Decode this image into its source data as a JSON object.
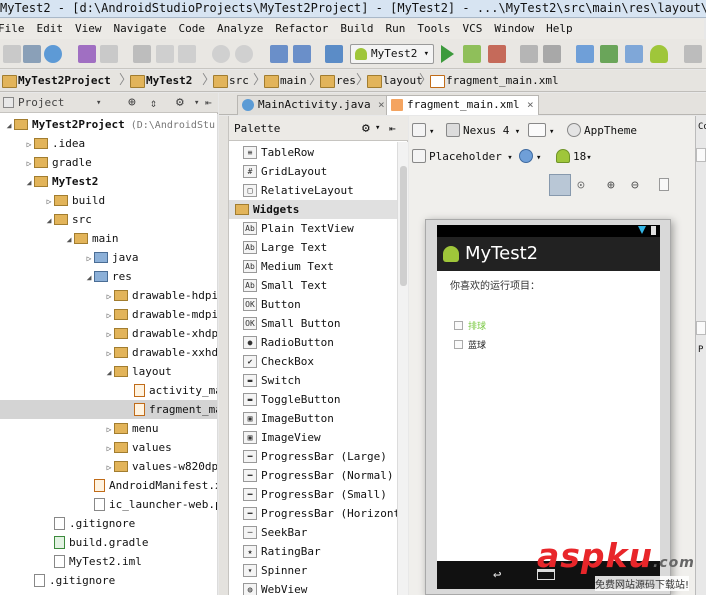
{
  "window": {
    "title": "MyTest2 - [d:\\AndroidStudioProjects\\MyTest2Project] - [MyTest2] - ...\\MyTest2\\src\\main\\res\\layout\\fragment_main.xml"
  },
  "menu": [
    "File",
    "Edit",
    "View",
    "Navigate",
    "Code",
    "Analyze",
    "Refactor",
    "Build",
    "Run",
    "Tools",
    "VCS",
    "Window",
    "Help"
  ],
  "toolbar": {
    "run_config": "MyTest2"
  },
  "breadcrumb": [
    "MyTest2Project",
    "MyTest2",
    "src",
    "main",
    "res",
    "layout",
    "fragment_main.xml"
  ],
  "project_pane": {
    "view_label": "Project",
    "items": [
      {
        "label": "MyTest2Project",
        "hint": "(D:\\AndroidStu",
        "level": 0,
        "kind": "folder",
        "bold": true
      },
      {
        "label": ".idea",
        "level": 1,
        "kind": "folder"
      },
      {
        "label": "gradle",
        "level": 1,
        "kind": "folder"
      },
      {
        "label": "MyTest2",
        "level": 1,
        "kind": "folder",
        "bold": true
      },
      {
        "label": "build",
        "level": 2,
        "kind": "folder"
      },
      {
        "label": "src",
        "level": 2,
        "kind": "folder"
      },
      {
        "label": "main",
        "level": 3,
        "kind": "folder"
      },
      {
        "label": "java",
        "level": 4,
        "kind": "folder-blue"
      },
      {
        "label": "res",
        "level": 4,
        "kind": "folder-blue"
      },
      {
        "label": "drawable-hdpi",
        "level": 5,
        "kind": "folder"
      },
      {
        "label": "drawable-mdpi",
        "level": 5,
        "kind": "folder"
      },
      {
        "label": "drawable-xhdpi",
        "level": 5,
        "kind": "folder"
      },
      {
        "label": "drawable-xxhdp",
        "level": 5,
        "kind": "folder"
      },
      {
        "label": "layout",
        "level": 5,
        "kind": "folder"
      },
      {
        "label": "activity_ma",
        "level": 6,
        "kind": "xml"
      },
      {
        "label": "fragment_ma",
        "level": 6,
        "kind": "xml",
        "selected": true
      },
      {
        "label": "menu",
        "level": 5,
        "kind": "folder"
      },
      {
        "label": "values",
        "level": 5,
        "kind": "folder"
      },
      {
        "label": "values-w820dp",
        "level": 5,
        "kind": "folder"
      },
      {
        "label": "AndroidManifest.xm",
        "level": 4,
        "kind": "xml"
      },
      {
        "label": "ic_launcher-web.pn",
        "level": 4,
        "kind": "file"
      },
      {
        "label": ".gitignore",
        "level": 2,
        "kind": "file"
      },
      {
        "label": "build.gradle",
        "level": 2,
        "kind": "gradle"
      },
      {
        "label": "MyTest2.iml",
        "level": 2,
        "kind": "file"
      },
      {
        "label": ".gitignore",
        "level": 1,
        "kind": "file"
      }
    ]
  },
  "editor_tabs": [
    {
      "label": "MainActivity.java",
      "active": false
    },
    {
      "label": "fragment_main.xml",
      "active": true
    }
  ],
  "palette": {
    "title": "Palette",
    "items": [
      {
        "label": "TableRow",
        "icon": "table-row-icon",
        "glyph": "≡"
      },
      {
        "label": "GridLayout",
        "icon": "grid-layout-icon",
        "glyph": "#"
      },
      {
        "label": "RelativeLayout",
        "icon": "relative-layout-icon",
        "glyph": "□"
      },
      {
        "label": "Widgets",
        "category": true
      },
      {
        "label": "Plain TextView",
        "icon": "textview-icon",
        "glyph": "Ab"
      },
      {
        "label": "Large Text",
        "icon": "large-text-icon",
        "glyph": "Ab"
      },
      {
        "label": "Medium Text",
        "icon": "medium-text-icon",
        "glyph": "Ab"
      },
      {
        "label": "Small Text",
        "icon": "small-text-icon",
        "glyph": "Ab"
      },
      {
        "label": "Button",
        "icon": "button-icon",
        "glyph": "OK"
      },
      {
        "label": "Small Button",
        "icon": "small-button-icon",
        "glyph": "OK"
      },
      {
        "label": "RadioButton",
        "icon": "radio-button-icon",
        "glyph": "●"
      },
      {
        "label": "CheckBox",
        "icon": "checkbox-icon",
        "glyph": "✔"
      },
      {
        "label": "Switch",
        "icon": "switch-icon",
        "glyph": "▬"
      },
      {
        "label": "ToggleButton",
        "icon": "toggle-button-icon",
        "glyph": "▬"
      },
      {
        "label": "ImageButton",
        "icon": "image-button-icon",
        "glyph": "▣"
      },
      {
        "label": "ImageView",
        "icon": "image-view-icon",
        "glyph": "▣"
      },
      {
        "label": "ProgressBar (Large)",
        "icon": "progressbar-icon",
        "glyph": "━"
      },
      {
        "label": "ProgressBar (Normal)",
        "icon": "progressbar-icon",
        "glyph": "━"
      },
      {
        "label": "ProgressBar (Small)",
        "icon": "progressbar-icon",
        "glyph": "━"
      },
      {
        "label": "ProgressBar (Horizontal)",
        "icon": "progressbar-icon",
        "glyph": "━"
      },
      {
        "label": "SeekBar",
        "icon": "seekbar-icon",
        "glyph": "─"
      },
      {
        "label": "RatingBar",
        "icon": "star-icon",
        "glyph": "★"
      },
      {
        "label": "Spinner",
        "icon": "spinner-icon",
        "glyph": "▾"
      },
      {
        "label": "WebView",
        "icon": "globe-icon",
        "glyph": "◍"
      }
    ]
  },
  "design_toolbar": {
    "device": "Nexus 4",
    "theme": "AppTheme",
    "placeholder": "Placeholder",
    "api": "18"
  },
  "device_preview": {
    "app_title": "MyTest2",
    "prompt": "你喜欢的运行项目：",
    "options": [
      {
        "label": "排球",
        "color": "#7ac943"
      },
      {
        "label": "蓝球",
        "color": "#222222"
      }
    ]
  },
  "watermark": {
    "brand": "aspku",
    "suffix": ".com",
    "tagline": "免费网站源码下载站!"
  },
  "colors": {
    "accent_green": "#3c9a3c",
    "folder": "#e2b45a",
    "watermark_red": "#e8262a"
  }
}
